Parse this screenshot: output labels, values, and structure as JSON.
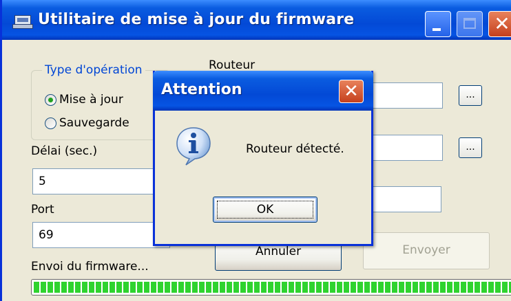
{
  "window": {
    "title": "Utilitaire de mise à jour du firmware",
    "controls": {
      "minimize": "minimize",
      "maximize": "maximize",
      "close": "✕"
    }
  },
  "operation": {
    "group_label": "Type d'opération",
    "options": [
      {
        "label": "Mise à jour",
        "checked": true
      },
      {
        "label": "Sauvegarde",
        "checked": false
      }
    ]
  },
  "router": {
    "label": "Routeur"
  },
  "fields": {
    "delay_label": "Délai (sec.)",
    "delay_value": "5",
    "port_label": "Port",
    "port_value": "69"
  },
  "browse_label": "...",
  "buttons": {
    "cancel": "Annuler",
    "send": "Envoyer"
  },
  "status_text": "Envoi du firmware...",
  "progress": {
    "fraction": 1.0,
    "color": "#2fd32f"
  },
  "dialog": {
    "title": "Attention",
    "close": "✕",
    "message": "Routeur détecté.",
    "ok": "OK",
    "icon": "info-icon"
  },
  "colors": {
    "titlebar": "#0a5ce0",
    "close_button": "#c5401d",
    "group_label": "#0046d5"
  }
}
